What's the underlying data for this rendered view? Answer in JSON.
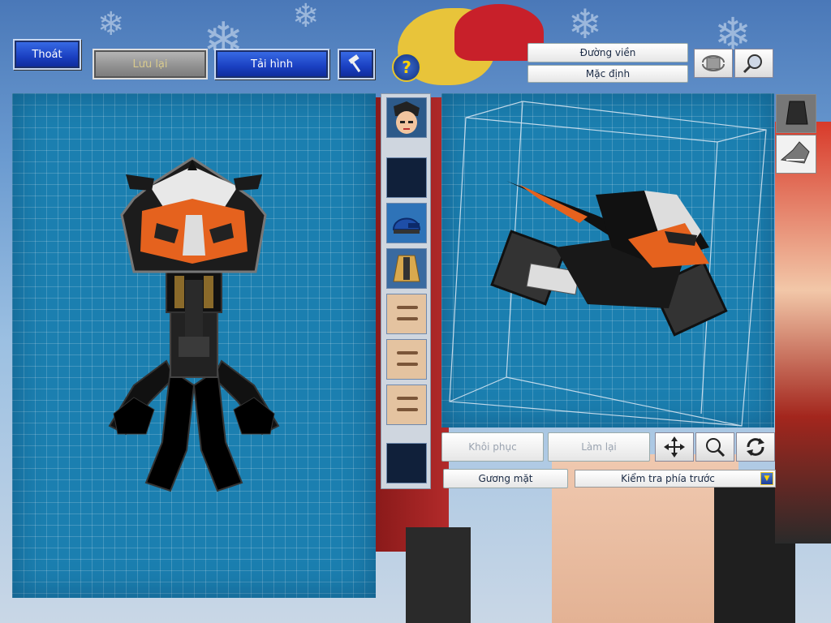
{
  "toolbar": {
    "exit_label": "Thoát",
    "save_label": "Lưu lại",
    "reload_label": "Tải hình",
    "hammer_icon": "hammer-icon",
    "help_icon": "help-icon",
    "outline_label": "Đường viền",
    "default_label": "Mặc định",
    "rotate_view_icon": "rotate-view-icon",
    "zoom_view_icon": "magnifier-icon"
  },
  "parts_strip": {
    "slots": [
      {
        "name": "character-head-thumb"
      },
      {
        "name": "empty-slot"
      },
      {
        "name": "helmet-thumb"
      },
      {
        "name": "body-thumb"
      },
      {
        "name": "face-part-thumb"
      },
      {
        "name": "face-part-thumb"
      },
      {
        "name": "face-part-thumb"
      },
      {
        "name": "empty-slot"
      }
    ]
  },
  "side_tabs": [
    "vehicle-tab",
    "wing-tab"
  ],
  "controls": {
    "restore_label": "Khôi phục",
    "redo_label": "Làm lại",
    "move_icon": "move-icon",
    "zoom_icon": "zoom-icon",
    "rotate_icon": "rotate-icon",
    "mirror_label": "Gương mặt",
    "view_select_value": "Kiểm tra phía trước"
  },
  "colors": {
    "grid_bg": "#1b7fb0",
    "button_blue": "#1a3fc0",
    "accent_orange": "#e5621e"
  }
}
